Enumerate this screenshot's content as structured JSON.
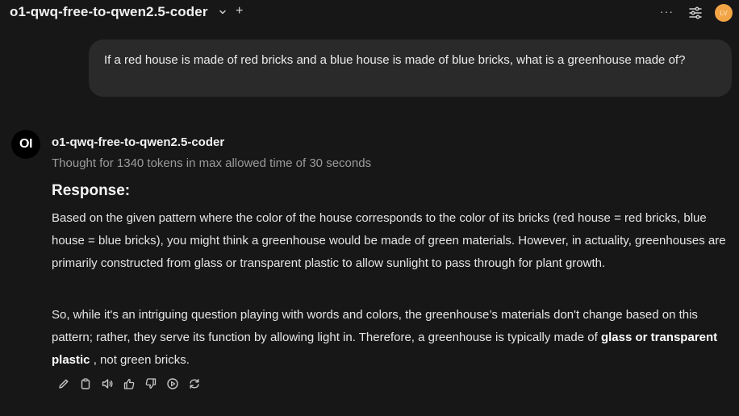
{
  "header": {
    "model_name": "o1-qwq-free-to-qwen2.5-coder",
    "new_tab_symbol": "+",
    "more_symbol": "···",
    "user_initials": "LV"
  },
  "user_message": {
    "text": "If a red house is made of red bricks and a blue house is made of blue bricks, what is a greenhouse made of?"
  },
  "assistant": {
    "avatar_text": "OI",
    "name": "o1-qwq-free-to-qwen2.5-coder",
    "thought": "Thought for 1340 tokens in max allowed time of 30 seconds",
    "heading": "Response:",
    "paragraph1": "Based on the given pattern where the color of the house corresponds to the color of its bricks (red house = red bricks, blue house = blue bricks), you might think a greenhouse would be made of green materials. However, in actuality, greenhouses are primarily constructed from glass or transparent plastic to allow sunlight to pass through for plant growth.",
    "paragraph2_before": "So, while it's an intriguing question playing with words and colors, the greenhouse’s materials don't change based on this pattern; rather, they serve its function by allowing light in. Therefore, a greenhouse is typically made of ",
    "paragraph2_bold": "glass or transparent plastic",
    "paragraph2_after": " , not green bricks."
  },
  "actions": [
    "edit-icon",
    "copy-icon",
    "read-aloud-icon",
    "thumbs-up-icon",
    "thumbs-down-icon",
    "continue-icon",
    "regenerate-icon"
  ],
  "colors": {
    "background": "#171717",
    "bubble": "#2a2a2a",
    "avatar_user": "#f2a546"
  }
}
